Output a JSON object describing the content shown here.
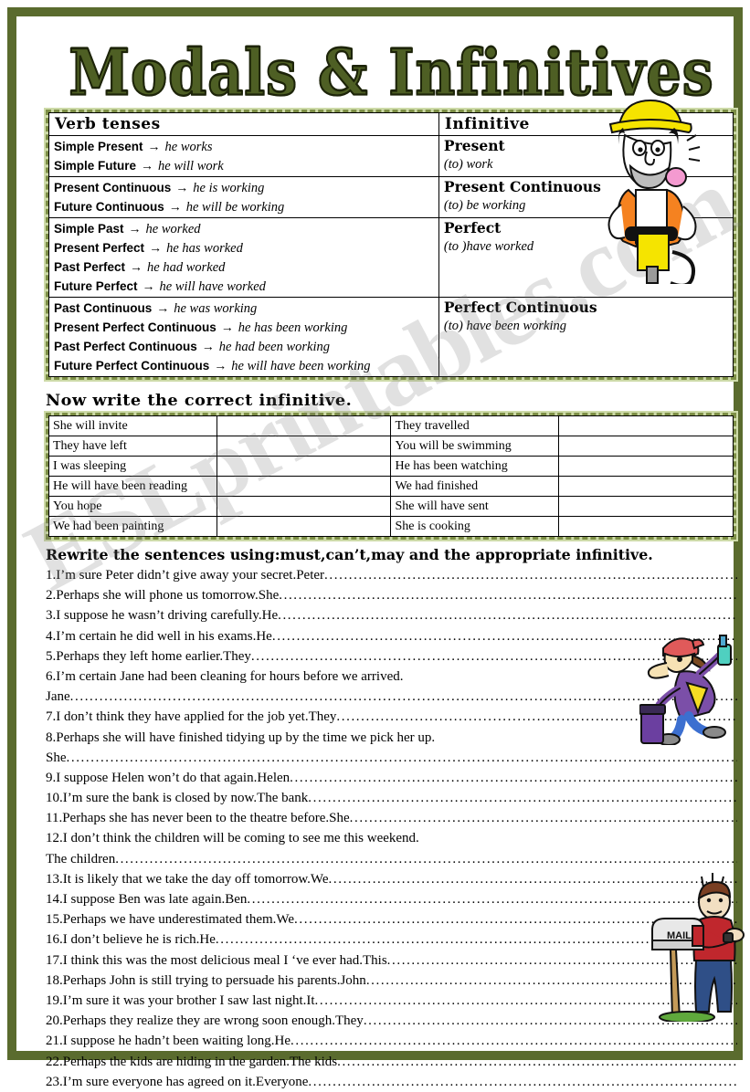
{
  "page": {
    "title": "Modals & Infinitives",
    "border_color": "#5a6b2e",
    "band_color": "#cddaa8",
    "dash_color": "#7d8f46",
    "title_color": "#4e5f24",
    "watermark": "ESLprintables.com"
  },
  "tense_table": {
    "col1_header": "Verb tenses",
    "col2_header": "Infinitive",
    "groups": [
      {
        "tenses": [
          {
            "name": "Simple Present",
            "arrow": "→",
            "example": "he works"
          },
          {
            "name": "Simple Future",
            "arrow": "→",
            "example": "he will work"
          }
        ],
        "infinitive_title": "Present",
        "infinitive_value": "(to) work"
      },
      {
        "tenses": [
          {
            "name": "Present Continuous",
            "arrow": "→",
            "example": "he is working"
          },
          {
            "name": "Future Continuous",
            "arrow": "→",
            "example": "he will be working"
          }
        ],
        "infinitive_title": "Present Continuous",
        "infinitive_value": "(to) be working"
      },
      {
        "tenses": [
          {
            "name": "Simple Past",
            "arrow": "→",
            "example": "he worked"
          },
          {
            "name": "Present Perfect",
            "arrow": "→",
            "example": "he has worked"
          },
          {
            "name": "Past Perfect",
            "arrow": "→",
            "example": "he had worked"
          },
          {
            "name": "Future Perfect",
            "arrow": "→",
            "example": "he will have worked"
          }
        ],
        "infinitive_title": "Perfect",
        "infinitive_value": "(to )have worked"
      },
      {
        "tenses": [
          {
            "name": "Past Continuous",
            "arrow": "→",
            "example": "he was working"
          },
          {
            "name": "Present Perfect Continuous",
            "arrow": "→",
            "example": "he has been working"
          },
          {
            "name": "Past Perfect Continuous",
            "arrow": "→",
            "example": "he had been working"
          },
          {
            "name": "Future Perfect Continuous",
            "arrow": "→",
            "example": "he will have been working"
          }
        ],
        "infinitive_title": "Perfect Continuous",
        "infinitive_value": "(to) have been working"
      }
    ]
  },
  "exercise2": {
    "heading": "Now write the correct infinitive.",
    "rows": [
      {
        "left": "She will invite",
        "left_answer": "",
        "right": "They travelled",
        "right_answer": ""
      },
      {
        "left": "They have left",
        "left_answer": "",
        "right": "You will be swimming",
        "right_answer": ""
      },
      {
        "left": "I was sleeping",
        "left_answer": "",
        "right": "He has been watching",
        "right_answer": ""
      },
      {
        "left": "He will have been reading",
        "left_answer": "",
        "right": "We had finished",
        "right_answer": ""
      },
      {
        "left": "You hope",
        "left_answer": "",
        "right": "She will have sent",
        "right_answer": ""
      },
      {
        "left": "We had been painting",
        "left_answer": "",
        "right": "She is cooking",
        "right_answer": ""
      }
    ]
  },
  "exercise3": {
    "heading": "Rewrite the sentences using:must,can’t,may and the appropriate infinitive.",
    "sentences": [
      {
        "text": "1.I’m sure Peter didn’t give away your secret.Peter",
        "dots": true
      },
      {
        "text": "2.Perhaps she will phone us tomorrow.She",
        "dots": true
      },
      {
        "text": "3.I suppose he wasn’t driving carefully.He",
        "dots": true
      },
      {
        "text": "4.I’m certain he did well in his exams.He",
        "dots": true
      },
      {
        "text": "5.Perhaps they left home earlier.They",
        "dots": true
      },
      {
        "text": "6.I’m certain Jane had been cleaning for hours before we arrived.",
        "dots": false
      },
      {
        "text": "Jane",
        "dots": true
      },
      {
        "text": "7.I don’t think they have applied for the job yet.They",
        "dots": true
      },
      {
        "text": "8.Perhaps she will have finished tidying up by the time we pick her up.",
        "dots": false
      },
      {
        "text": "She",
        "dots": true
      },
      {
        "text": "9.I suppose Helen won’t do that again.Helen",
        "dots": true
      },
      {
        "text": "10.I’m sure the bank is closed by now.The bank",
        "dots": true
      },
      {
        "text": "11.Perhaps she has never been to the theatre before.She",
        "dots": true
      },
      {
        "text": "12.I don’t think the children will be coming to see me this weekend.",
        "dots": false
      },
      {
        "text": "The children",
        "dots": true
      },
      {
        "text": "13.It is likely that we take the day off tomorrow.We",
        "dots": true
      },
      {
        "text": "14.I suppose Ben was late again.Ben",
        "dots": true
      },
      {
        "text": "15.Perhaps we have underestimated them.We",
        "dots": true
      },
      {
        "text": "16.I don’t believe he is rich.He",
        "dots": true
      },
      {
        "text": "17.I think this was the most delicious meal I ‘ve ever had.This",
        "dots": true
      },
      {
        "text": "18.Perhaps John is still trying to persuade his parents.John",
        "dots": true
      },
      {
        "text": "19.I’m sure it was your brother I saw last night.It",
        "dots": true
      },
      {
        "text": "20.Perhaps they realize they are wrong  soon enough.They",
        "dots": true
      },
      {
        "text": "21.I suppose he hadn’t been waiting long.He",
        "dots": true
      },
      {
        "text": "22.Perhaps the kids are hiding in the garden.The kids",
        "dots": true
      },
      {
        "text": "23.I’m sure everyone has agreed on it.Everyone",
        "dots": true
      }
    ]
  },
  "cliparts": {
    "worker": "construction-worker-with-jackhammer",
    "cleaner": "woman-vacuuming-clipart",
    "mailbox_label": "MAIL",
    "waiting_man": "man-waiting-by-mailbox"
  }
}
